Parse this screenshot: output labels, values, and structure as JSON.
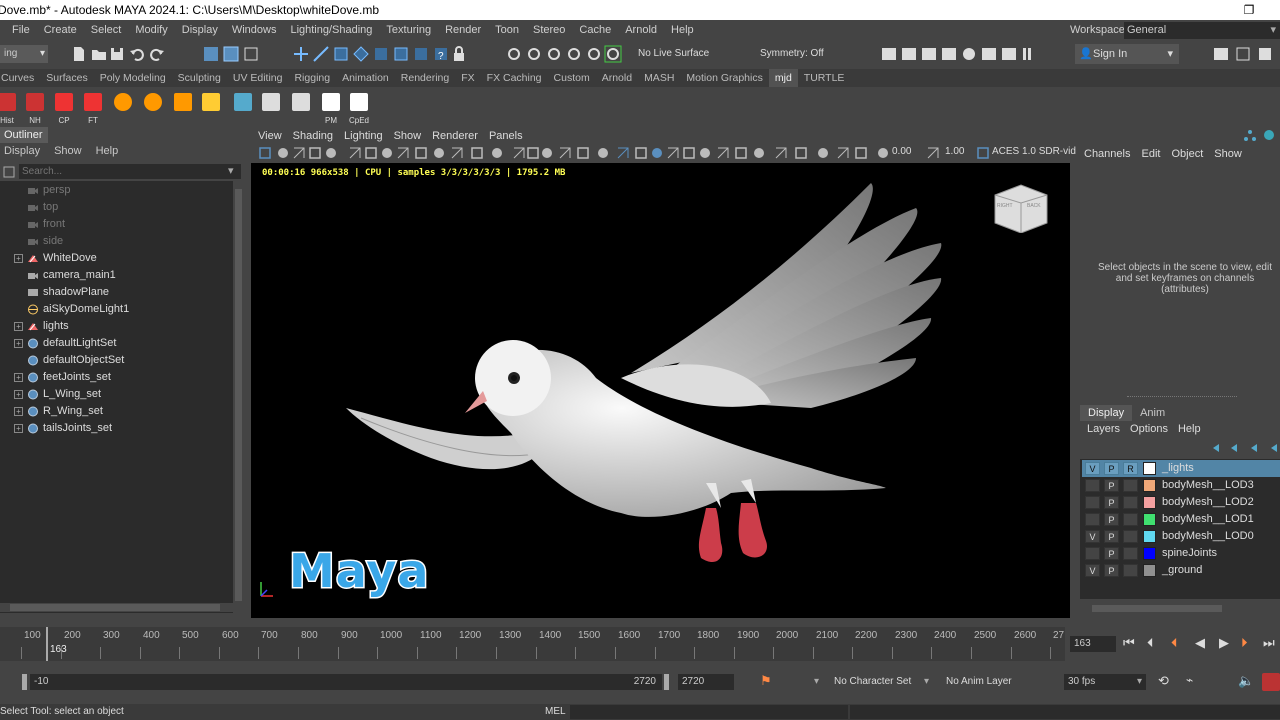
{
  "window": {
    "title": "Dove.mb* - Autodesk MAYA 2024.1: C:\\Users\\M\\Desktop\\whiteDove.mb",
    "restore_glyph": "❐"
  },
  "menubar": {
    "items": [
      "File",
      "Create",
      "Select",
      "Modify",
      "Display",
      "Windows",
      "Lighting/Shading",
      "Texturing",
      "Render",
      "Toon",
      "Stereo",
      "Cache",
      "Arnold",
      "Help"
    ],
    "workspace_label": "Workspace:",
    "workspace_value": "General"
  },
  "statusline": {
    "menuset": "ing",
    "live_surface": "No Live Surface",
    "symmetry": "Symmetry: Off",
    "sign_in": "Sign In"
  },
  "shelf": {
    "tabs": [
      "Curves",
      "Surfaces",
      "Poly Modeling",
      "Sculpting",
      "UV Editing",
      "Rigging",
      "Animation",
      "Rendering",
      "FX",
      "FX Caching",
      "Custom",
      "Arnold",
      "MASH",
      "Motion Graphics",
      "mjd",
      "TURTLE"
    ],
    "active_tab": "mjd",
    "icons": [
      {
        "label": "Hist"
      },
      {
        "label": "NH"
      },
      {
        "label": "CP"
      },
      {
        "label": "FT"
      },
      {
        "label": ""
      },
      {
        "label": ""
      },
      {
        "label": ""
      },
      {
        "label": ""
      },
      {
        "label": ""
      },
      {
        "label": ""
      },
      {
        "label": ""
      },
      {
        "label": "PM"
      },
      {
        "label": "CpEd"
      }
    ]
  },
  "outliner": {
    "title": "Outliner",
    "menu": [
      "Display",
      "Show",
      "Help"
    ],
    "search_placeholder": "Search...",
    "items": [
      {
        "label": "persp",
        "dim": true,
        "expandable": false,
        "icon": "camera-icon"
      },
      {
        "label": "top",
        "dim": true,
        "expandable": false,
        "icon": "camera-icon"
      },
      {
        "label": "front",
        "dim": true,
        "expandable": false,
        "icon": "camera-icon"
      },
      {
        "label": "side",
        "dim": true,
        "expandable": false,
        "icon": "camera-icon"
      },
      {
        "label": "WhiteDove",
        "dim": false,
        "expandable": true,
        "icon": "group-icon"
      },
      {
        "label": "camera_main1",
        "dim": false,
        "expandable": false,
        "icon": "camera-icon"
      },
      {
        "label": "shadowPlane",
        "dim": false,
        "expandable": false,
        "icon": "mesh-icon"
      },
      {
        "label": "aiSkyDomeLight1",
        "dim": false,
        "expandable": false,
        "icon": "skydome-icon"
      },
      {
        "label": "lights",
        "dim": false,
        "expandable": true,
        "icon": "group-icon"
      },
      {
        "label": "defaultLightSet",
        "dim": false,
        "expandable": true,
        "icon": "set-icon"
      },
      {
        "label": "defaultObjectSet",
        "dim": false,
        "expandable": false,
        "icon": "set-icon"
      },
      {
        "label": "feetJoints_set",
        "dim": false,
        "expandable": true,
        "icon": "set-icon"
      },
      {
        "label": "L_Wing_set",
        "dim": false,
        "expandable": true,
        "icon": "set-icon"
      },
      {
        "label": "R_Wing_set",
        "dim": false,
        "expandable": true,
        "icon": "set-icon"
      },
      {
        "label": "tailsJoints_set",
        "dim": false,
        "expandable": true,
        "icon": "set-icon"
      }
    ]
  },
  "viewport": {
    "menu": [
      "View",
      "Shading",
      "Lighting",
      "Show",
      "Renderer",
      "Panels"
    ],
    "exposure": "0.00",
    "gamma": "1.00",
    "colorspace": "ACES 1.0 SDR-vid",
    "hud": "00:00:16 966x538 | CPU | samples 3/3/3/3/3/3 | 1795.2 MB",
    "viewcube": {
      "face_right": "RIGHT",
      "face_back": "BACK"
    },
    "watermark": "Maya"
  },
  "channels": {
    "menu": [
      "Channels",
      "Edit",
      "Object",
      "Show"
    ],
    "message": "Select objects in the scene to view, edit and set keyframes on channels (attributes)"
  },
  "layers": {
    "tabs": [
      "Display",
      "Anim"
    ],
    "menu": [
      "Layers",
      "Options",
      "Help"
    ],
    "rows": [
      {
        "v": "V",
        "p": "P",
        "r": "R",
        "color": "#ffffff",
        "name": "_lights",
        "selected": true
      },
      {
        "v": "",
        "p": "P",
        "r": "",
        "color": "#f0a878",
        "name": "bodyMesh__LOD3",
        "selected": false
      },
      {
        "v": "",
        "p": "P",
        "r": "",
        "color": "#f4a0a0",
        "name": "bodyMesh__LOD2",
        "selected": false
      },
      {
        "v": "",
        "p": "P",
        "r": "",
        "color": "#40e070",
        "name": "bodyMesh__LOD1",
        "selected": false
      },
      {
        "v": "V",
        "p": "P",
        "r": "",
        "color": "#60d8f0",
        "name": "bodyMesh__LOD0",
        "selected": false
      },
      {
        "v": "",
        "p": "P",
        "r": "",
        "color": "#0000ff",
        "name": "spineJoints",
        "selected": false
      },
      {
        "v": "V",
        "p": "P",
        "r": "",
        "color": "#909090",
        "name": "_ground",
        "selected": false
      }
    ]
  },
  "timeline": {
    "ticks": [
      "100",
      "200",
      "300",
      "400",
      "500",
      "600",
      "700",
      "800",
      "900",
      "1000",
      "1100",
      "1200",
      "1300",
      "1400",
      "1500",
      "1600",
      "1700",
      "1800",
      "1900",
      "2000",
      "2100",
      "2200",
      "2300",
      "2400",
      "2500",
      "2600",
      "27"
    ],
    "current_frame": "163",
    "current_field": "163"
  },
  "range": {
    "start": "-10",
    "end_inner": "2720",
    "end_outer": "2720",
    "character_set": "No Character Set",
    "anim_layer": "No Anim Layer",
    "fps": "30 fps"
  },
  "helpline": {
    "text": "Select Tool: select an object",
    "mel_label": "MEL"
  }
}
